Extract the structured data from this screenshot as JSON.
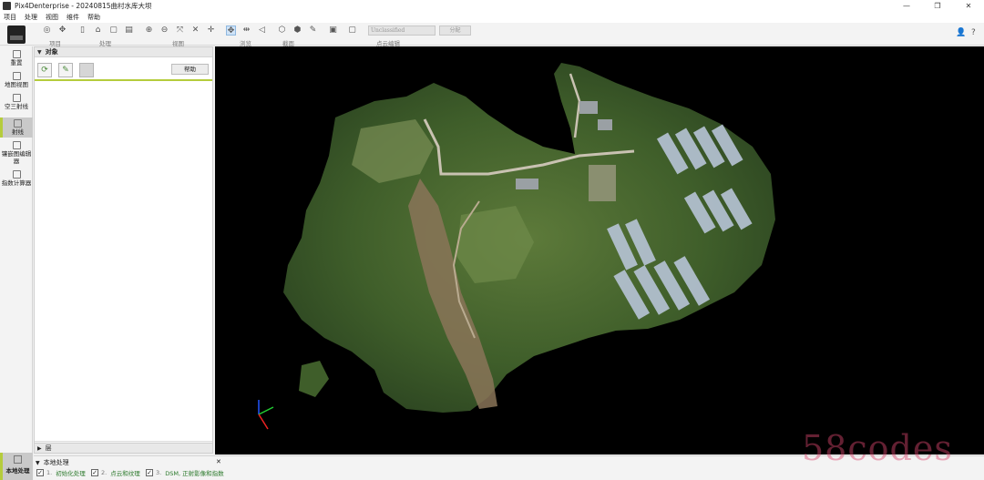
{
  "window": {
    "title": "Pix4Denterprise - 20240815曲村水库大坝",
    "controls": [
      "—",
      "❐",
      "✕"
    ]
  },
  "menu": [
    "项目",
    "处理",
    "视图",
    "维件",
    "帮助"
  ],
  "toolbar": {
    "groups": [
      "项目",
      "处理",
      "视图",
      "浏览",
      "截面",
      "点云编辑"
    ],
    "select_value": "Unclassified",
    "classify_button": "分配"
  },
  "sidebar": {
    "items": [
      {
        "label": "重置",
        "icon": "home-icon"
      },
      {
        "label": "地图视图",
        "icon": "map-icon"
      },
      {
        "label": "空三射线",
        "icon": "rays-icon"
      },
      {
        "label": "射线",
        "icon": "cylinder-icon"
      },
      {
        "label": "镶嵌图编辑器",
        "icon": "mosaic-icon"
      },
      {
        "label": "指数计算器",
        "icon": "calculator-icon"
      }
    ],
    "bottom_item": "本地处理"
  },
  "objects_panel": {
    "title": "对象",
    "help_button": "帮助",
    "layers_title": "层"
  },
  "processing": {
    "title": "本地处理",
    "steps": [
      {
        "num": "1.",
        "label": "初始化处理",
        "checked": true
      },
      {
        "num": "2.",
        "label": "点云和纹理",
        "checked": true
      },
      {
        "num": "3.",
        "label": "DSM, 正射影像和指数",
        "checked": true
      }
    ]
  },
  "watermark": "58codes"
}
